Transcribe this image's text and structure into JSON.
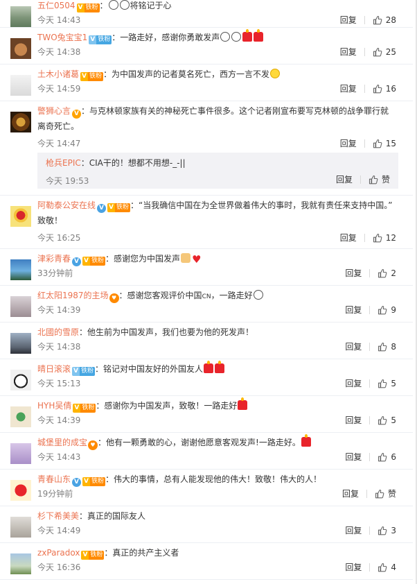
{
  "labels": {
    "reply": "回复",
    "like_empty": "赞"
  },
  "comments": [
    {
      "name": "五仁0504",
      "badge": "fan-gold",
      "text": "：",
      "emoji": [
        "cry",
        "cry"
      ],
      "text2": "将铭记于心",
      "time": "今天 14:43",
      "likes": "28",
      "avatar": "forest",
      "height": 46
    },
    {
      "name": "TWO兔宝宝1",
      "badge": "fan-iron",
      "text": "：一路走好，感谢你勇敢发声",
      "emoji": [
        "cry",
        "cry",
        "candle",
        "candle"
      ],
      "time": "今天 14:38",
      "likes": "25",
      "avatar": "monkey",
      "height": 53
    },
    {
      "name": "土木小诸葛",
      "badge": "fan-gold",
      "text": "：为中国发声的记者莫名死亡，西方一言不发",
      "emoji": [
        "cool"
      ],
      "time": "今天 14:59",
      "likes": "16",
      "avatar": "sketch",
      "height": 53
    },
    {
      "name": "警狮心言",
      "badge": "v-orange",
      "text": "：与克林顿家族有关的神秘死亡事件很多。这个记者刚宣布要写克林顿的战争罪行就",
      "text_line2": "离奇死亡。",
      "time": "今天 14:47",
      "likes": "15",
      "avatar": "lion",
      "height": 120,
      "reply": {
        "name": "枪兵EPIC",
        "text": "：CIA干的！想都不用想-_-||",
        "time": "今天 19:53",
        "likes": "赞"
      }
    },
    {
      "name": "阿勒泰公安在线",
      "badge": "v-blue-fan",
      "text": "：“当我确信中国在为全世界做着伟大的事时，我就有责任来支持中国。”",
      "text_line2": "致敬！",
      "time": "今天 16:25",
      "likes": "12",
      "avatar": "police",
      "height": 77
    },
    {
      "name": "津彩青春",
      "badge": "v-blue-fan",
      "text": "：感谢您为中国发声",
      "emoji": [
        "thumb",
        "heart-red"
      ],
      "time": "33分钟前",
      "likes": "2",
      "avatar": "city",
      "height": 53
    },
    {
      "name": "红太阳1987的主场",
      "badge": "heart",
      "text": "：感谢您客观评价中国",
      "text_sup": "CN",
      "text3": "，一路走好",
      "emoji": [
        "cry"
      ],
      "time": "今天 14:39",
      "likes": "9",
      "avatar": "girl",
      "height": 53
    },
    {
      "name": "北國的雪原",
      "badge": "",
      "text": "：他生前为中国发声，我们也要为他的死发声！",
      "time": "今天 14:38",
      "likes": "8",
      "avatar": "street",
      "height": 53
    },
    {
      "name": "晴日滚滚",
      "badge": "fan-iron",
      "text": "：铭记对中国友好的外国友人",
      "emoji": [
        "candle",
        "candle"
      ],
      "time": "今天 15:13",
      "likes": "5",
      "avatar": "panda",
      "height": 53
    },
    {
      "name": "HYH吴倩",
      "badge": "fan-gold",
      "text": "：感谢你为中国发声，致敬！一路走好",
      "emoji": [
        "candle"
      ],
      "time": "今天 14:39",
      "likes": "5",
      "avatar": "cartoon",
      "height": 53
    },
    {
      "name": "城堡里的成宝",
      "badge": "heart",
      "text": "：他有一颗勇敢的心，谢谢他愿意客观发声!一路走好。",
      "emoji": [
        "candle"
      ],
      "time": "今天 14:43",
      "likes": "6",
      "avatar": "purple",
      "height": 53
    },
    {
      "name": "青春山东",
      "badge": "v-blue-fan",
      "text": "：伟大的事情，总有人能发现他的伟大！致敬！伟大的人！",
      "time": "19分钟前",
      "likes": "赞",
      "avatar": "youth",
      "height": 53
    },
    {
      "name": "杉下希美美",
      "badge": "",
      "text": "：真正的国际友人",
      "time": "今天 14:49",
      "likes": "3",
      "avatar": "woman",
      "height": 53
    },
    {
      "name": "zxParadox",
      "badge": "fan-gold",
      "text": "：真正的共产主义者",
      "time": "今天 16:36",
      "likes": "4",
      "avatar": "landscape",
      "height": 53
    }
  ],
  "badges": {
    "fan_level": "V",
    "fan_gold_text": "铁粉",
    "fan_iron_text": "铁粉",
    "v": "V"
  },
  "colors": {
    "name": "#eb7350",
    "meta": "#808080",
    "sub_bg": "#f2f2f5"
  }
}
